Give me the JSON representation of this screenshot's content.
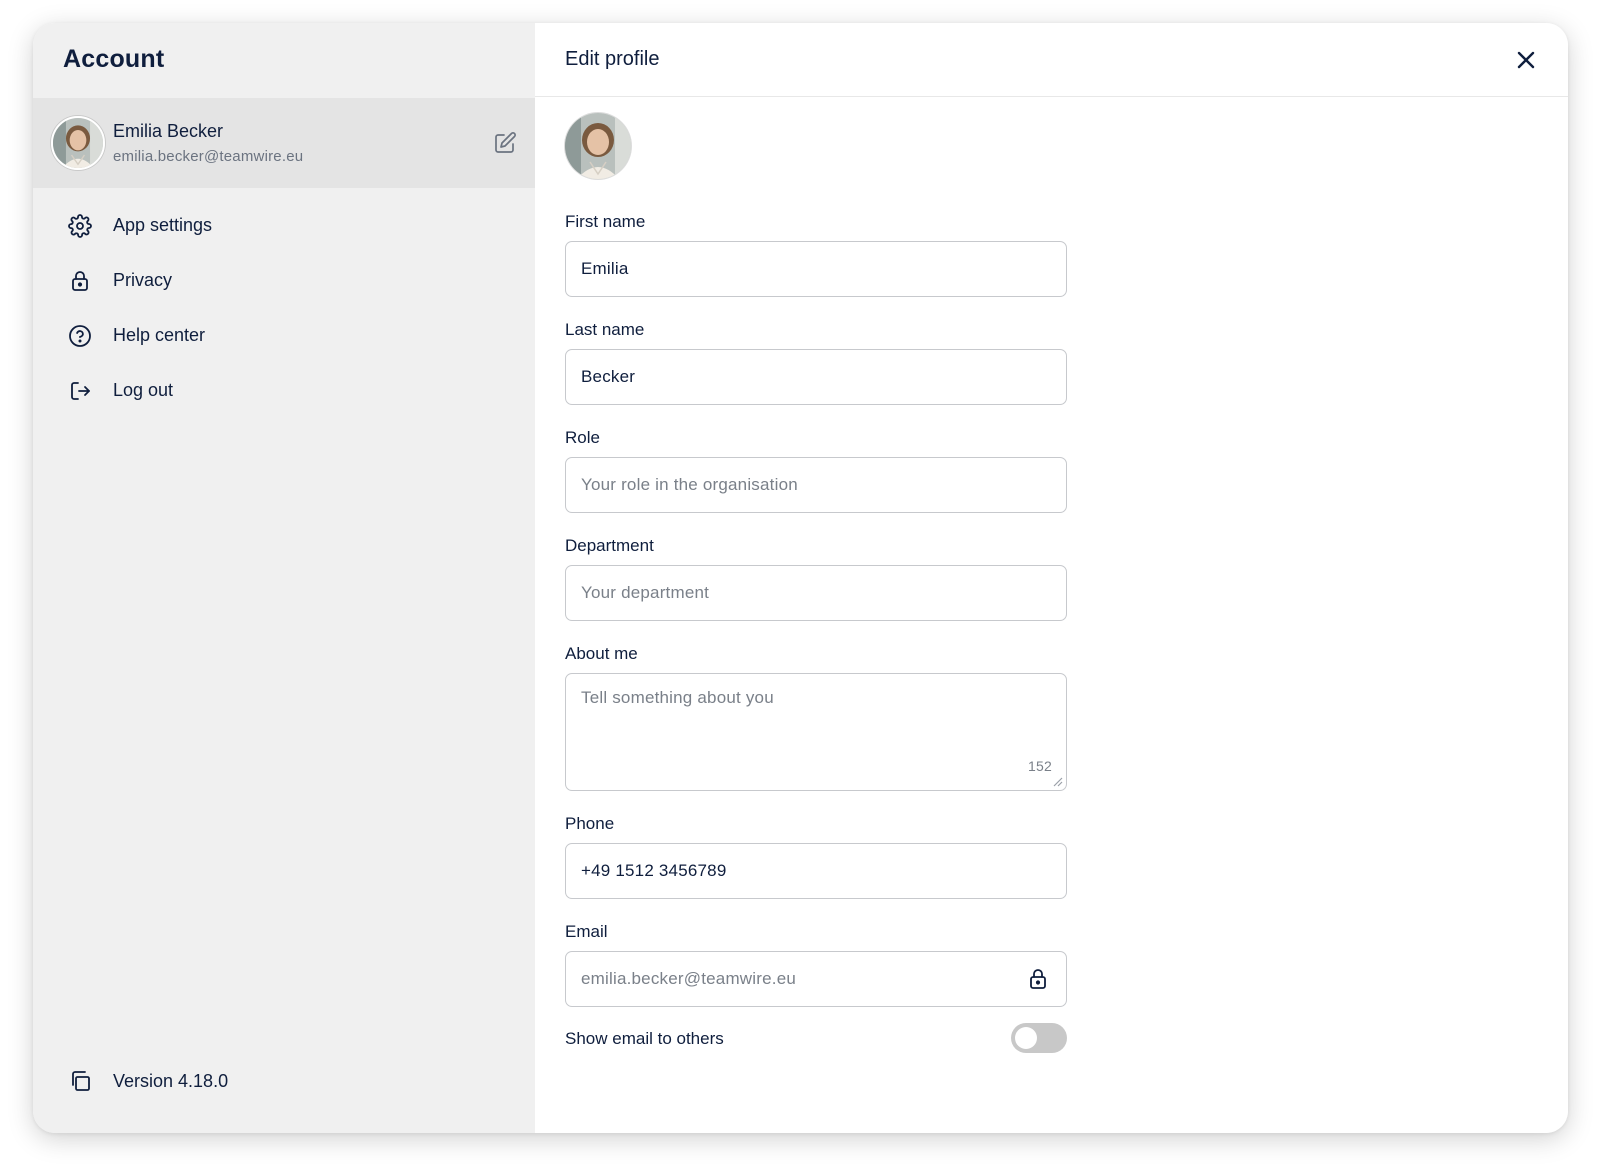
{
  "sidebar": {
    "title": "Account",
    "profile": {
      "name": "Emilia Becker",
      "email": "emilia.becker@teamwire.eu"
    },
    "items": [
      {
        "label": "App settings",
        "icon": "gear-icon"
      },
      {
        "label": "Privacy",
        "icon": "lock-icon"
      },
      {
        "label": "Help center",
        "icon": "help-circle-icon"
      },
      {
        "label": "Log out",
        "icon": "logout-icon"
      }
    ],
    "version": "Version 4.18.0"
  },
  "main": {
    "title": "Edit profile",
    "fields": {
      "first_name": {
        "label": "First name",
        "value": "Emilia"
      },
      "last_name": {
        "label": "Last name",
        "value": "Becker"
      },
      "role": {
        "label": "Role",
        "placeholder": "Your role in the organisation"
      },
      "department": {
        "label": "Department",
        "placeholder": "Your department"
      },
      "about": {
        "label": "About me",
        "placeholder": "Tell something about you",
        "counter": "152"
      },
      "phone": {
        "label": "Phone",
        "value": "+49 1512 3456789"
      },
      "email": {
        "label": "Email",
        "value": "emilia.becker@teamwire.eu"
      }
    },
    "show_email": {
      "label": "Show email to others",
      "enabled": false
    }
  },
  "colors": {
    "text": "#0f1e3d",
    "muted": "#6b7380",
    "sidebar_bg": "#f0f0f0",
    "selected_bg": "#e4e4e4",
    "border": "#c7c9cd"
  }
}
